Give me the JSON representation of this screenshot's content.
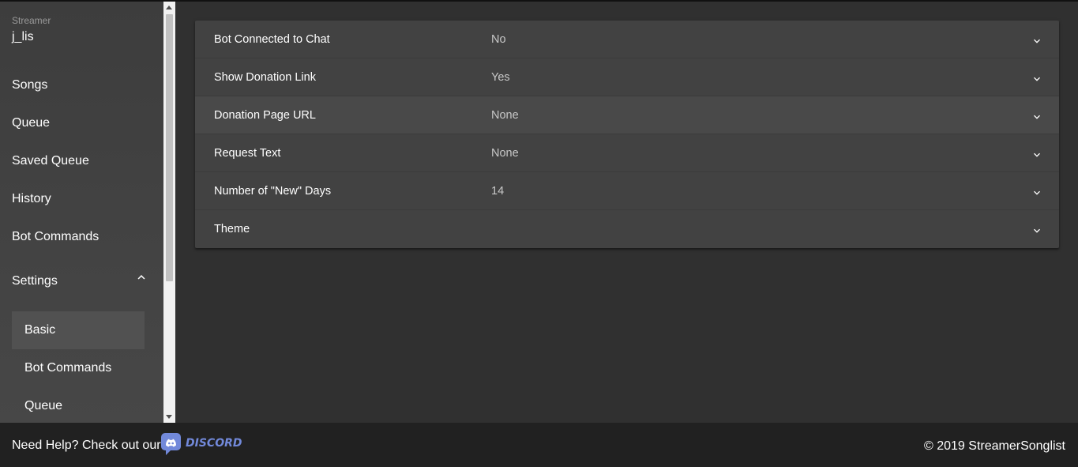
{
  "sidebar": {
    "streamer_label": "Streamer",
    "streamer_name": "j_lis",
    "nav": [
      {
        "label": "Songs"
      },
      {
        "label": "Queue"
      },
      {
        "label": "Saved Queue"
      },
      {
        "label": "History"
      },
      {
        "label": "Bot Commands"
      },
      {
        "label": "Settings"
      }
    ],
    "settings_sub": [
      {
        "label": "Basic",
        "active": true
      },
      {
        "label": "Bot Commands"
      },
      {
        "label": "Queue"
      }
    ]
  },
  "settings": {
    "rows": [
      {
        "label": "Bot Connected to Chat",
        "value": "No"
      },
      {
        "label": "Show Donation Link",
        "value": "Yes"
      },
      {
        "label": "Donation Page URL",
        "value": "None"
      },
      {
        "label": "Request Text",
        "value": "None"
      },
      {
        "label": "Number of \"New\" Days",
        "value": "14"
      },
      {
        "label": "Theme",
        "value": ""
      }
    ]
  },
  "footer": {
    "help_text": "Need Help? Check out our",
    "discord_label": "DISCORD",
    "copyright": "© 2019 StreamerSonglist"
  },
  "colors": {
    "background": "#303030",
    "panel": "#424242",
    "footer": "#212121",
    "discord": "#7289da"
  },
  "icons": {
    "row_expand": "chevron-down-icon",
    "settings_collapse": "chevron-up-icon",
    "discord": "discord-logo-icon"
  }
}
